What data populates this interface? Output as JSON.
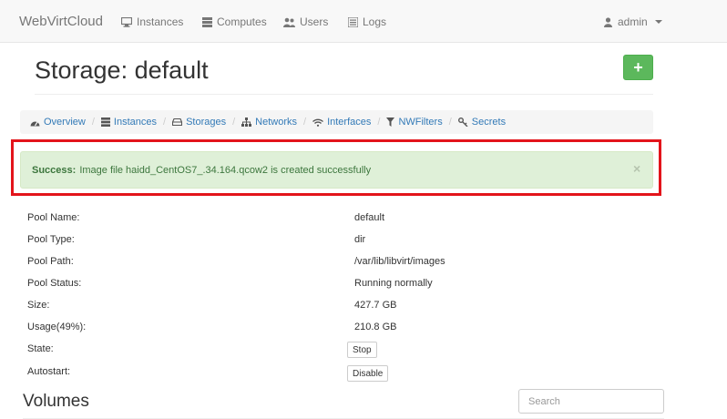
{
  "navbar": {
    "brand": "WebVirtCloud",
    "items": [
      {
        "label": "Instances",
        "icon": "monitor-icon"
      },
      {
        "label": "Computes",
        "icon": "server-icon"
      },
      {
        "label": "Users",
        "icon": "users-icon"
      },
      {
        "label": "Logs",
        "icon": "list-icon"
      }
    ],
    "user": {
      "label": "admin",
      "icon": "user-icon"
    }
  },
  "header": {
    "title": "Storage: default",
    "add_label": "+"
  },
  "breadcrumb": [
    {
      "label": "Overview",
      "icon": "dashboard-icon"
    },
    {
      "label": "Instances",
      "icon": "server-icon"
    },
    {
      "label": "Storages",
      "icon": "hdd-icon"
    },
    {
      "label": "Networks",
      "icon": "sitemap-icon"
    },
    {
      "label": "Interfaces",
      "icon": "wifi-icon"
    },
    {
      "label": "NWFilters",
      "icon": "filter-icon"
    },
    {
      "label": "Secrets",
      "icon": "key-icon"
    }
  ],
  "breadcrumb_separator": "/",
  "alert": {
    "strong": "Success:",
    "message": "Image file haidd_CentOS7_.34.164.qcow2 is created successfully",
    "close": "×"
  },
  "pool": {
    "name_label": "Pool Name:",
    "name_value": "default",
    "type_label": "Pool Type:",
    "type_value": "dir",
    "path_label": "Pool Path:",
    "path_value": "/var/lib/libvirt/images",
    "status_label": "Pool Status:",
    "status_value": "Running normally",
    "size_label": "Size:",
    "size_value": "427.7 GB",
    "usage_label": "Usage(49%):",
    "usage_value": "210.8 GB",
    "state_label": "State:",
    "state_button": "Stop",
    "autostart_label": "Autostart:",
    "autostart_button": "Disable"
  },
  "volumes": {
    "title": "Volumes",
    "search_placeholder": "Search"
  },
  "colors": {
    "success_bg": "#dff0d8",
    "success_text": "#3c763d",
    "highlight_border": "#e3141b",
    "link": "#337ab7",
    "add_button": "#5cb85c"
  }
}
